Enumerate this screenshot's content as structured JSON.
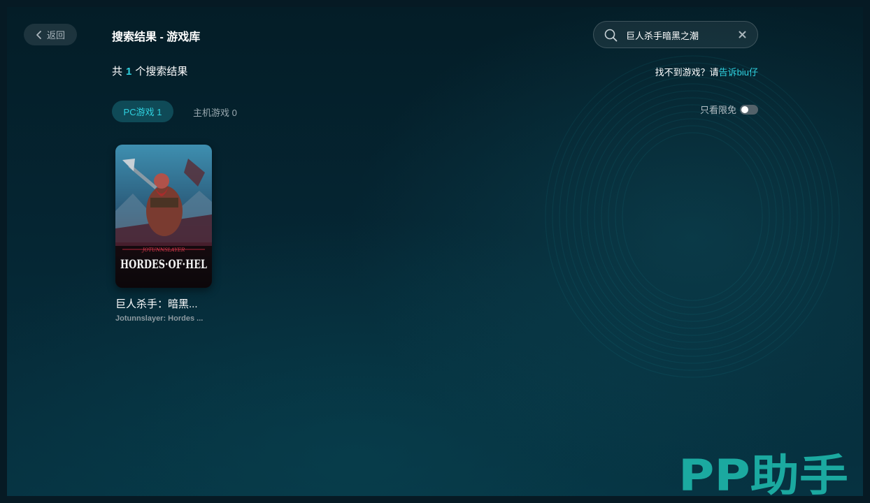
{
  "nav": {
    "back_label": "返回",
    "page_title": "搜索结果 - 游戏库"
  },
  "search": {
    "value": "巨人杀手暗黑之潮"
  },
  "results": {
    "count_prefix": "共",
    "count": "1",
    "count_suffix": "个搜索结果",
    "not_found_text": "找不到游戏？请",
    "not_found_link": "告诉biu仔"
  },
  "tabs": [
    {
      "label": "PC游戏 1",
      "active": true
    },
    {
      "label": "主机游戏 0",
      "active": false
    }
  ],
  "filter": {
    "free_only_label": "只看限免",
    "free_only_on": false
  },
  "games": [
    {
      "name": "巨人杀手：暗黑...",
      "name_en": "Jotunnslayer: Hordes ...",
      "cover_subtitle": "JOTUNNSLAYER",
      "cover_title": "HORDES·OF·HEL"
    }
  ],
  "watermark": {
    "text": "PP助手"
  },
  "colors": {
    "accent": "#2fd2e0",
    "watermark": "#1ba9a0",
    "tab_active_bg": "#0f4a57"
  },
  "icons": [
    "chevron-left-icon",
    "search-icon",
    "close-icon"
  ]
}
